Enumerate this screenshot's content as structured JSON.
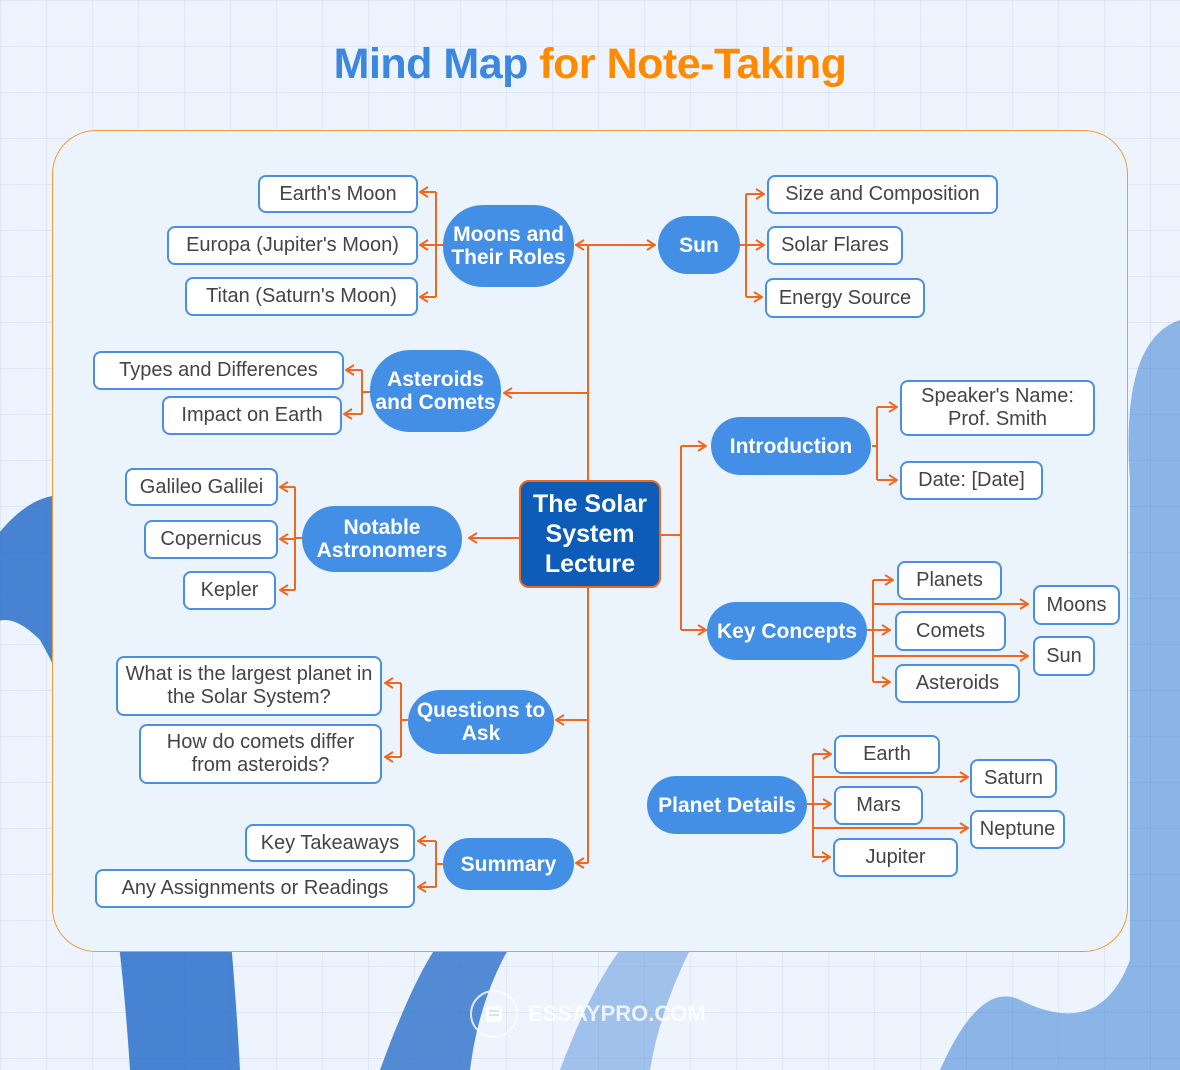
{
  "title": {
    "part1": "Mind Map",
    "part2": "for Note-Taking"
  },
  "colors": {
    "title_blue": "#3c87e0",
    "title_orange": "#ff8a00",
    "node_blue": "#438fe6",
    "center_blue": "#0d5cb8",
    "connector": "#f0671e",
    "box_border": "#4b8fe2"
  },
  "center": {
    "label": "The Solar System Lecture"
  },
  "branches": {
    "moons": {
      "label": "Moons and Their Roles",
      "children": [
        "Earth's Moon",
        "Europa (Jupiter's Moon)",
        "Titan (Saturn's Moon)"
      ]
    },
    "sun": {
      "label": "Sun",
      "children": [
        "Size and Composition",
        "Solar Flares",
        "Energy Source"
      ]
    },
    "asteroids": {
      "label": "Asteroids and Comets",
      "children": [
        "Types and Differences",
        "Impact on Earth"
      ]
    },
    "introduction": {
      "label": "Introduction",
      "children": [
        "Speaker's Name: Prof. Smith",
        "Date: [Date]"
      ]
    },
    "astronomers": {
      "label": "Notable Astronomers",
      "children": [
        "Galileo Galilei",
        "Copernicus",
        "Kepler"
      ]
    },
    "key_concepts": {
      "label": "Key Concepts",
      "children": [
        "Planets",
        "Moons",
        "Comets",
        "Sun",
        "Asteroids"
      ]
    },
    "questions": {
      "label": "Questions to Ask",
      "children": [
        "What is the largest planet in the Solar System?",
        "How do comets differ from asteroids?"
      ]
    },
    "planet_details": {
      "label": "Planet Details",
      "children": [
        "Earth",
        "Saturn",
        "Mars",
        "Neptune",
        "Jupiter"
      ]
    },
    "summary": {
      "label": "Summary",
      "children": [
        "Key Takeaways",
        "Any Assignments or Readings"
      ]
    }
  },
  "watermark": {
    "text": "ESSAYPRO.COM",
    "icon": "notepad-icon"
  }
}
